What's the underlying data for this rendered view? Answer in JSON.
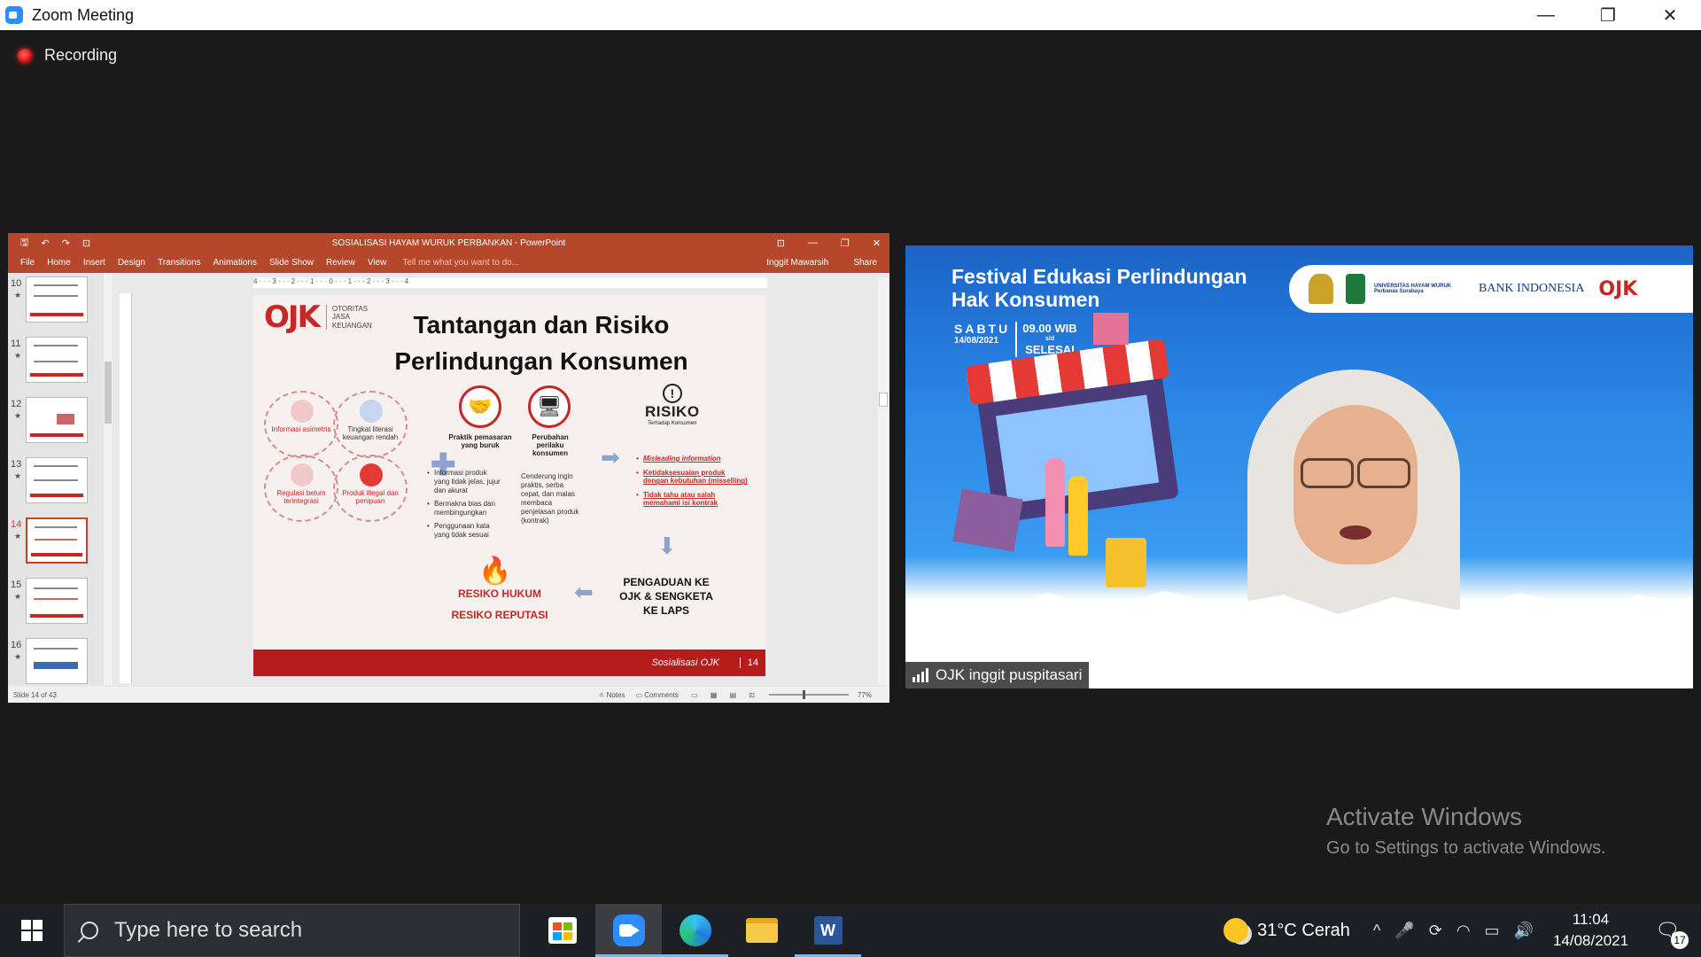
{
  "window": {
    "title": "Zoom Meeting",
    "minimize": "—",
    "restore": "❐",
    "close": "✕"
  },
  "recording": {
    "label": "Recording"
  },
  "powerpoint": {
    "qat": {
      "save": "🖫",
      "undo": "↶",
      "redo": "↷",
      "present": "⊡"
    },
    "doc_title": "SOSIALISASI HAYAM WURUK PERBANKAN - PowerPoint",
    "win": {
      "ribbon_opts": "⊡",
      "minimize": "—",
      "restore": "❐",
      "close": "✕"
    },
    "tabs": [
      "File",
      "Home",
      "Insert",
      "Design",
      "Transitions",
      "Animations",
      "Slide Show",
      "Review",
      "View"
    ],
    "tell_me": "Tell me what you want to do...",
    "user": "Inggit Mawarsih",
    "share": "Share",
    "thumbnails": [
      {
        "num": "10",
        "star": "★"
      },
      {
        "num": "11",
        "star": "★"
      },
      {
        "num": "12",
        "star": "★"
      },
      {
        "num": "13",
        "star": "★"
      },
      {
        "num": "14",
        "star": "★"
      },
      {
        "num": "15",
        "star": "★"
      },
      {
        "num": "16",
        "star": "★"
      }
    ],
    "ruler_marks": "4 · · · 3 · · · 2 · · · 1 · · · 0 · · · 1 · · · 2 · · · 3 · · · 4",
    "slide": {
      "logo_mark": "OJK",
      "logo_sub": [
        "OTORITAS",
        "JASA",
        "KEUANGAN"
      ],
      "title_line1": "Tantangan dan Risiko",
      "title_line2": "Perlindungan Konsumen",
      "circles": [
        {
          "label": "Informasi asimetris"
        },
        {
          "label": "Tingkat literasi keuangan rendah"
        },
        {
          "label": "Regulasi belum terintegrasi"
        },
        {
          "label": "Produk illegal dan penipuan"
        }
      ],
      "plus": "✚",
      "praktik_label": "Praktik pemasaran yang buruk",
      "praktik_list": [
        "Informasi produk yang tidak jelas, jujur dan akurat",
        "Bermakna bias dan membingungkan",
        "Penggunaan kata yang tidak sesuai"
      ],
      "perubahan_label": "Perubahan perilaku konsumen",
      "perubahan_text": "Cenderung ingin praktis, serba cepat, dan malas membaca penjelasan produk (kontrak)",
      "risk_icon": "!",
      "risk_title": "RISIKO",
      "risk_sub": "Terhadap Konsumen",
      "risk_list": [
        "Misleading information",
        "Ketidaksesuaian produk dengan kebutuhan (misselling)",
        "Tidak tahu atau salah memahami isi kontrak"
      ],
      "arrow_right": "➡",
      "arrow_down": "⬇",
      "arrow_left": "⬅",
      "fire": "🔥",
      "resiko_hukum": "RESIKO HUKUM",
      "resiko_reputasi": "RESIKO REPUTASI",
      "pengaduan": "PENGADUAN KE OJK & SENGKETA KE LAPS",
      "footer_text": "Sosialisasi OJK",
      "slide_number": "14"
    },
    "status": {
      "slide_of": "Slide 14 of 43",
      "notes": "≐ Notes",
      "comments": "▭ Comments",
      "views": "▭ ▦ ▤ ⊡",
      "zoom": "77%"
    }
  },
  "video": {
    "festival_title_line1": "Festival Edukasi Perlindungan",
    "festival_title_line2": "Hak Konsumen",
    "day": "SABTU",
    "date": "14/08/2021",
    "time": "09.00 WIB",
    "until": "s/d",
    "end": "SELESAI",
    "sponsor_univ": "UNIVERSITAS HAYAM WURUK Perbanas Surabaya",
    "sponsor_bi": "BANK INDONESIA",
    "sponsor_ojk": "OJK",
    "participant_name": "OJK inggit puspitasari"
  },
  "watermark": {
    "line1": "Activate Windows",
    "line2": "Go to Settings to activate Windows."
  },
  "taskbar": {
    "search_placeholder": "Type here to search",
    "word_letter": "W",
    "weather": "31°C  Cerah",
    "tray_icons": {
      "chevron": "^",
      "mic": "🎤",
      "sync": "⟳",
      "wifi": "◠",
      "battery": "▭",
      "volume": "🔊"
    },
    "time": "11:04",
    "date": "14/08/2021",
    "notif_icon": "🗨",
    "notif_count": "17"
  }
}
